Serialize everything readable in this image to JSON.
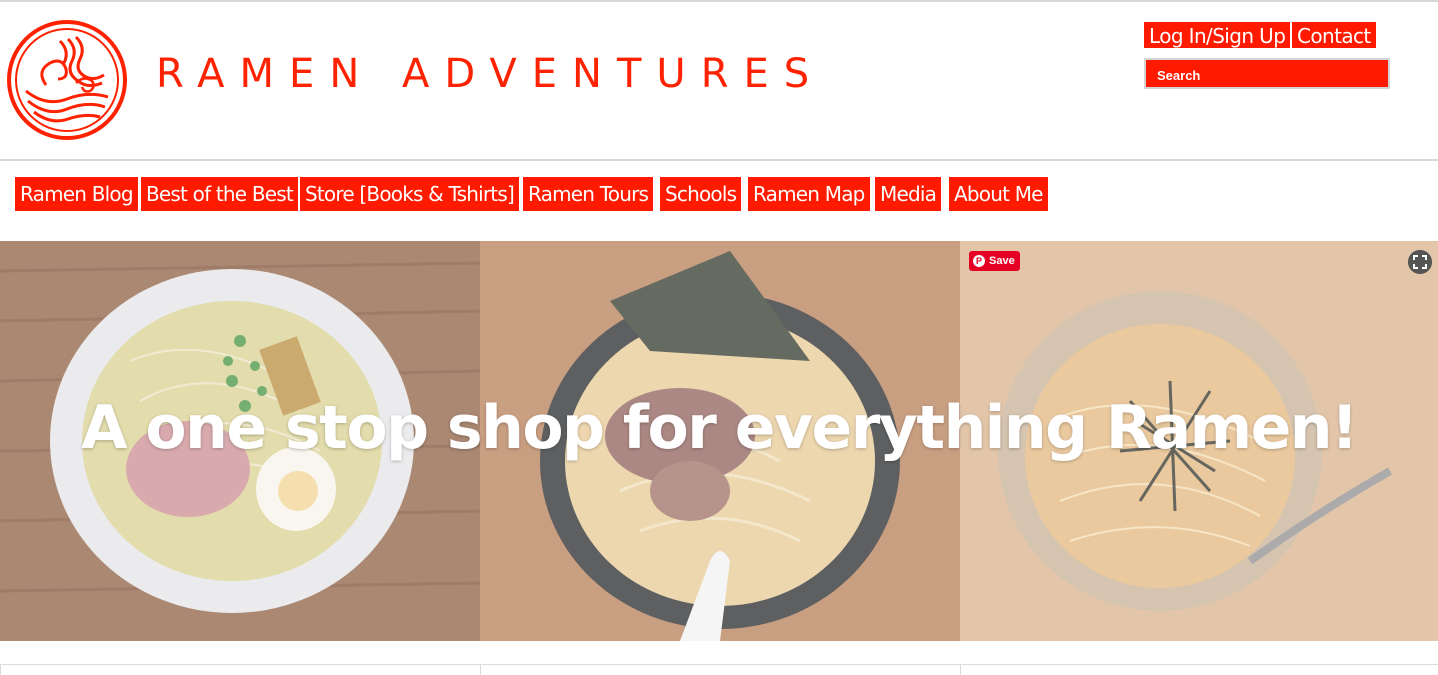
{
  "brand": {
    "name": "RAMEN ADVENTURES",
    "logo_icon": "ramen-bowl-logo-icon",
    "accent_color": "#ff1a00"
  },
  "header": {
    "login_label": "Log In/Sign Up",
    "contact_label": "Contact",
    "search_placeholder": "Search"
  },
  "nav": {
    "items": [
      {
        "label": "Ramen Blog"
      },
      {
        "label": "Best of the Best"
      },
      {
        "label": "Store [Books & Tshirts]"
      },
      {
        "label": "Ramen Tours"
      },
      {
        "label": "Schools"
      },
      {
        "label": "Ramen Map"
      },
      {
        "label": "Media"
      },
      {
        "label": "About Me"
      }
    ]
  },
  "hero": {
    "headline": "A one stop shop for everything Ramen!",
    "pin_label": "Save",
    "pin_icon": "pinterest-icon",
    "expand_icon": "expand-icon"
  }
}
